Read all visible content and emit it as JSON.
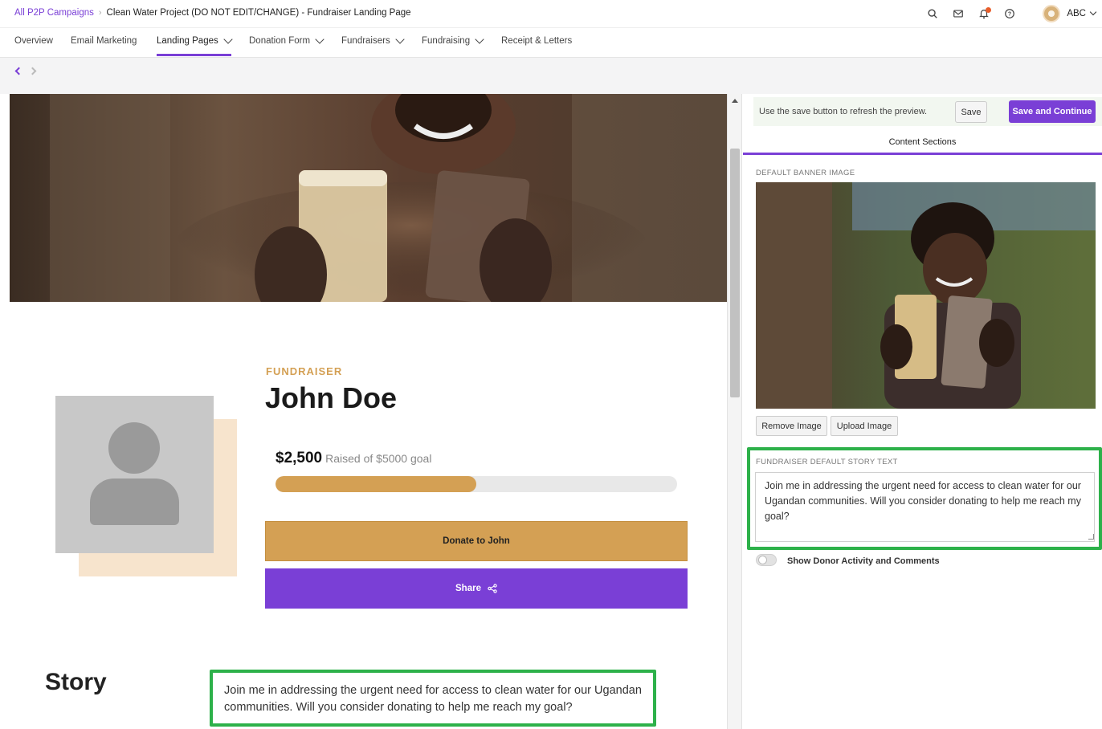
{
  "breadcrumb": {
    "root": "All P2P Campaigns",
    "current": "Clean Water Project (DO NOT EDIT/CHANGE) - Fundraiser Landing Page"
  },
  "header": {
    "org": "ABC",
    "icons": [
      "search-icon",
      "mail-icon",
      "bell-icon",
      "help-icon"
    ]
  },
  "nav": {
    "items": [
      {
        "label": "Overview",
        "dropdown": false
      },
      {
        "label": "Email Marketing",
        "dropdown": false
      },
      {
        "label": "Landing Pages",
        "dropdown": true,
        "active": true
      },
      {
        "label": "Donation Form",
        "dropdown": true
      },
      {
        "label": "Fundraisers",
        "dropdown": true
      },
      {
        "label": "Fundraising",
        "dropdown": true
      },
      {
        "label": "Receipt & Letters",
        "dropdown": false
      }
    ]
  },
  "preview": {
    "label": "FUNDRAISER",
    "name": "John Doe",
    "raised_amount": "$2,500",
    "raised_goal": "Raised of $5000 goal",
    "progress_fraction": 0.5,
    "donate_label": "Donate to John",
    "share_label": "Share",
    "story_heading": "Story",
    "story_text": "Join me in addressing the urgent need for access to clean water for our Ugandan communities. Will you consider donating to help me reach my goal?"
  },
  "panel": {
    "hint": "Use the save button to refresh the preview.",
    "save_label": "Save",
    "save_continue_label": "Save and Continue",
    "tab_label": "Content Sections",
    "banner_label": "DEFAULT BANNER IMAGE",
    "remove_image_label": "Remove Image",
    "upload_image_label": "Upload Image",
    "story_label": "FUNDRAISER DEFAULT STORY TEXT",
    "story_value": "Join me in addressing the urgent need for access to clean water for our Ugandan communities. Will you consider donating to help me reach my goal?",
    "toggle_label": "Show Donor Activity and Comments",
    "toggle_on": false
  },
  "colors": {
    "brand_purple": "#7a3fd6",
    "accent_gold": "#d4a054",
    "highlight_green": "#2db14a"
  }
}
